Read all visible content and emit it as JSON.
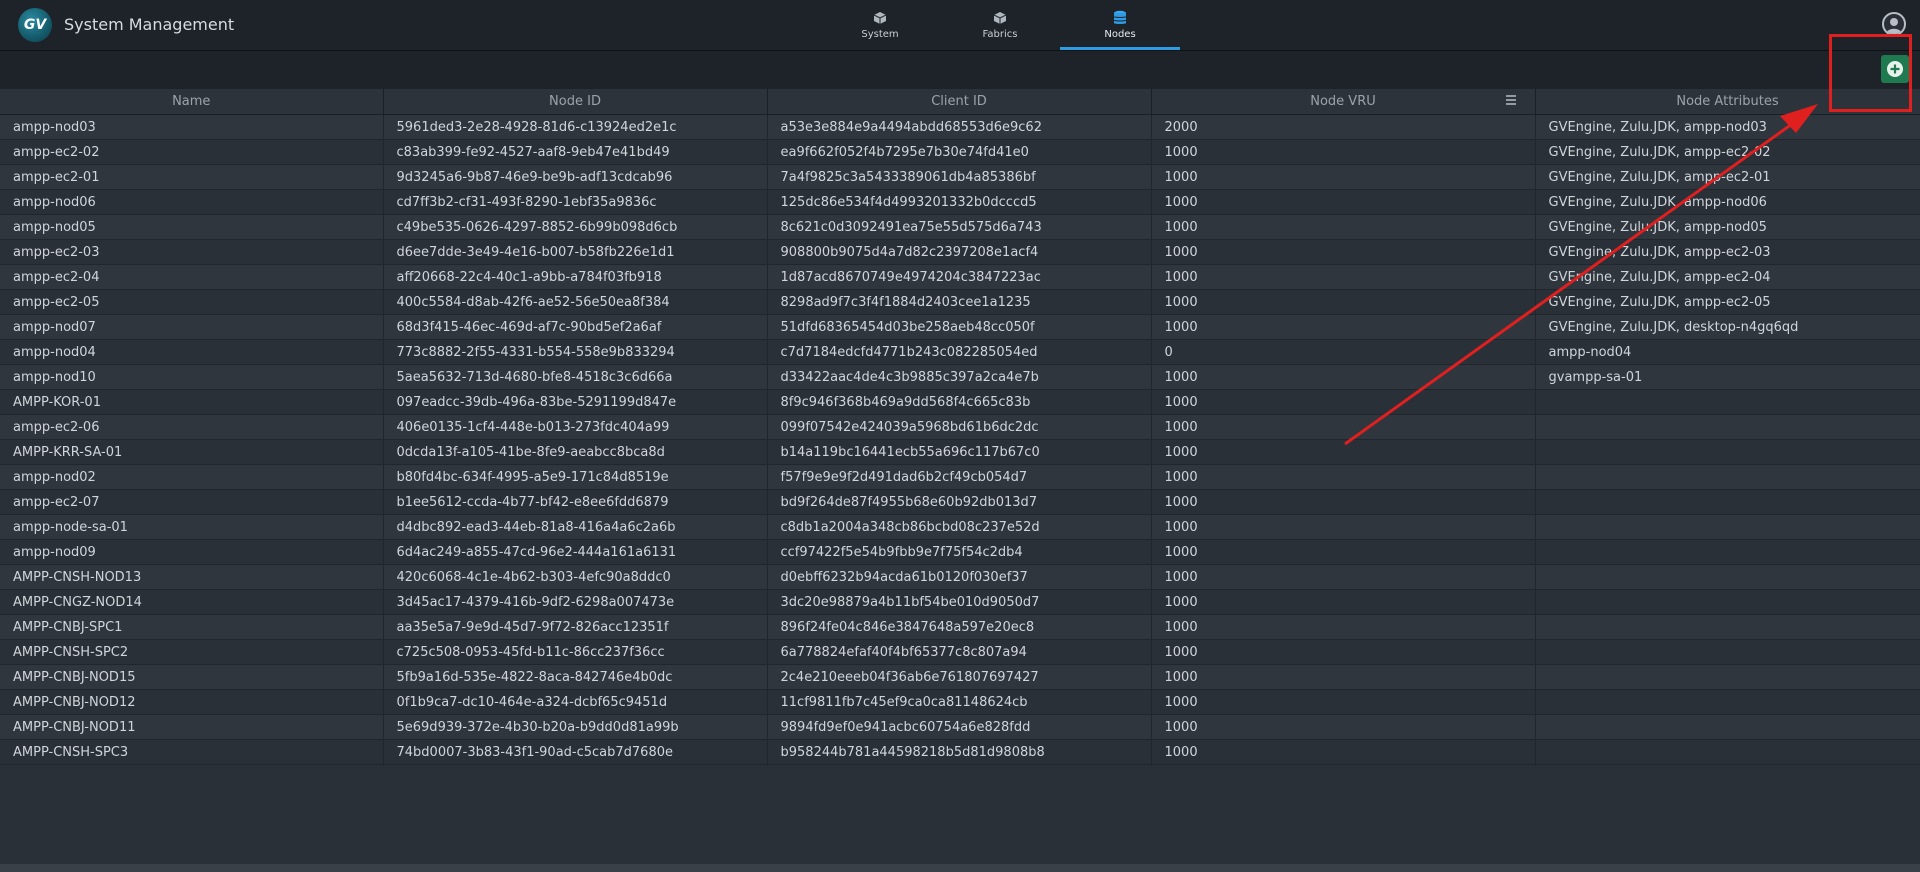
{
  "app": {
    "title": "System Management",
    "logo_text": "GV"
  },
  "nav": {
    "tabs": [
      {
        "label": "System",
        "icon": "cube-icon",
        "active": false
      },
      {
        "label": "Fabrics",
        "icon": "cube-icon",
        "active": false
      },
      {
        "label": "Nodes",
        "icon": "database-icon",
        "active": true
      }
    ]
  },
  "colors": {
    "accent": "#2e9be3",
    "add_button": "#1f7a4f",
    "annotation": "#e01f1f"
  },
  "table": {
    "columns": [
      "Name",
      "Node ID",
      "Client ID",
      "Node VRU",
      "Node Attributes"
    ],
    "rows": [
      [
        "ampp-nod03",
        "5961ded3-2e28-4928-81d6-c13924ed2e1c",
        "a53e3e884e9a4494abdd68553d6e9c62",
        "2000",
        "GVEngine, Zulu.JDK, ampp-nod03"
      ],
      [
        "ampp-ec2-02",
        "c83ab399-fe92-4527-aaf8-9eb47e41bd49",
        "ea9f662f052f4b7295e7b30e74fd41e0",
        "1000",
        "GVEngine, Zulu.JDK, ampp-ec2-02"
      ],
      [
        "ampp-ec2-01",
        "9d3245a6-9b87-46e9-be9b-adf13cdcab96",
        "7a4f9825c3a5433389061db4a85386bf",
        "1000",
        "GVEngine, Zulu.JDK, ampp-ec2-01"
      ],
      [
        "ampp-nod06",
        "cd7ff3b2-cf31-493f-8290-1ebf35a9836c",
        "125dc86e534f4d4993201332b0dcccd5",
        "1000",
        "GVEngine, Zulu.JDK, ampp-nod06"
      ],
      [
        "ampp-nod05",
        "c49be535-0626-4297-8852-6b99b098d6cb",
        "8c621c0d3092491ea75e55d575d6a743",
        "1000",
        "GVEngine, Zulu.JDK, ampp-nod05"
      ],
      [
        "ampp-ec2-03",
        "d6ee7dde-3e49-4e16-b007-b58fb226e1d1",
        "908800b9075d4a7d82c2397208e1acf4",
        "1000",
        "GVEngine, Zulu.JDK, ampp-ec2-03"
      ],
      [
        "ampp-ec2-04",
        "aff20668-22c4-40c1-a9bb-a784f03fb918",
        "1d87acd8670749e4974204c3847223ac",
        "1000",
        "GVEngine, Zulu.JDK, ampp-ec2-04"
      ],
      [
        "ampp-ec2-05",
        "400c5584-d8ab-42f6-ae52-56e50ea8f384",
        "8298ad9f7c3f4f1884d2403cee1a1235",
        "1000",
        "GVEngine, Zulu.JDK, ampp-ec2-05"
      ],
      [
        "ampp-nod07",
        "68d3f415-46ec-469d-af7c-90bd5ef2a6af",
        "51dfd68365454d03be258aeb48cc050f",
        "1000",
        "GVEngine, Zulu.JDK, desktop-n4gq6qd"
      ],
      [
        "ampp-nod04",
        "773c8882-2f55-4331-b554-558e9b833294",
        "c7d7184edcfd4771b243c082285054ed",
        "0",
        "ampp-nod04"
      ],
      [
        "ampp-nod10",
        "5aea5632-713d-4680-bfe8-4518c3c6d66a",
        "d33422aac4de4c3b9885c397a2ca4e7b",
        "1000",
        "gvampp-sa-01"
      ],
      [
        "AMPP-KOR-01",
        "097eadcc-39db-496a-83be-5291199d847e",
        "8f9c946f368b469a9dd568f4c665c83b",
        "1000",
        ""
      ],
      [
        "ampp-ec2-06",
        "406e0135-1cf4-448e-b013-273fdc404a99",
        "099f07542e424039a5968bd61b6dc2dc",
        "1000",
        ""
      ],
      [
        "AMPP-KRR-SA-01",
        "0dcda13f-a105-41be-8fe9-aeabcc8bca8d",
        "b14a119bc16441ecb55a696c117b67c0",
        "1000",
        ""
      ],
      [
        "ampp-nod02",
        "b80fd4bc-634f-4995-a5e9-171c84d8519e",
        "f57f9e9e9f2d491dad6b2cf49cb054d7",
        "1000",
        ""
      ],
      [
        "ampp-ec2-07",
        "b1ee5612-ccda-4b77-bf42-e8ee6fdd6879",
        "bd9f264de87f4955b68e60b92db013d7",
        "1000",
        ""
      ],
      [
        "ampp-node-sa-01",
        "d4dbc892-ead3-44eb-81a8-416a4a6c2a6b",
        "c8db1a2004a348cb86bcbd08c237e52d",
        "1000",
        ""
      ],
      [
        "ampp-nod09",
        "6d4ac249-a855-47cd-96e2-444a161a6131",
        "ccf97422f5e54b9fbb9e7f75f54c2db4",
        "1000",
        ""
      ],
      [
        "AMPP-CNSH-NOD13",
        "420c6068-4c1e-4b62-b303-4efc90a8ddc0",
        "d0ebff6232b94acda61b0120f030ef37",
        "1000",
        ""
      ],
      [
        "AMPP-CNGZ-NOD14",
        "3d45ac17-4379-416b-9df2-6298a007473e",
        "3dc20e98879a4b11bf54be010d9050d7",
        "1000",
        ""
      ],
      [
        "AMPP-CNBJ-SPC1",
        "aa35e5a7-9e9d-45d7-9f72-826acc12351f",
        "896f24fe04c846e3847648a597e20ec8",
        "1000",
        ""
      ],
      [
        "AMPP-CNSH-SPC2",
        "c725c508-0953-45fd-b11c-86cc237f36cc",
        "6a778824efaf40f4bf65377c8c807a94",
        "1000",
        ""
      ],
      [
        "AMPP-CNBJ-NOD15",
        "5fb9a16d-535e-4822-8aca-842746e4b0dc",
        "2c4e210eeeb04f36ab6e761807697427",
        "1000",
        ""
      ],
      [
        "AMPP-CNBJ-NOD12",
        "0f1b9ca7-dc10-464e-a324-dcbf65c9451d",
        "11cf9811fb7c45ef9ca0ca81148624cb",
        "1000",
        ""
      ],
      [
        "AMPP-CNBJ-NOD11",
        "5e69d939-372e-4b30-b20a-b9dd0d81a99b",
        "9894fd9ef0e941acbc60754a6e828fdd",
        "1000",
        ""
      ],
      [
        "AMPP-CNSH-SPC3",
        "74bd0007-3b83-43f1-90ad-c5cab7d7680e",
        "b958244b781a44598218b5d81d9808b8",
        "1000",
        ""
      ]
    ]
  }
}
